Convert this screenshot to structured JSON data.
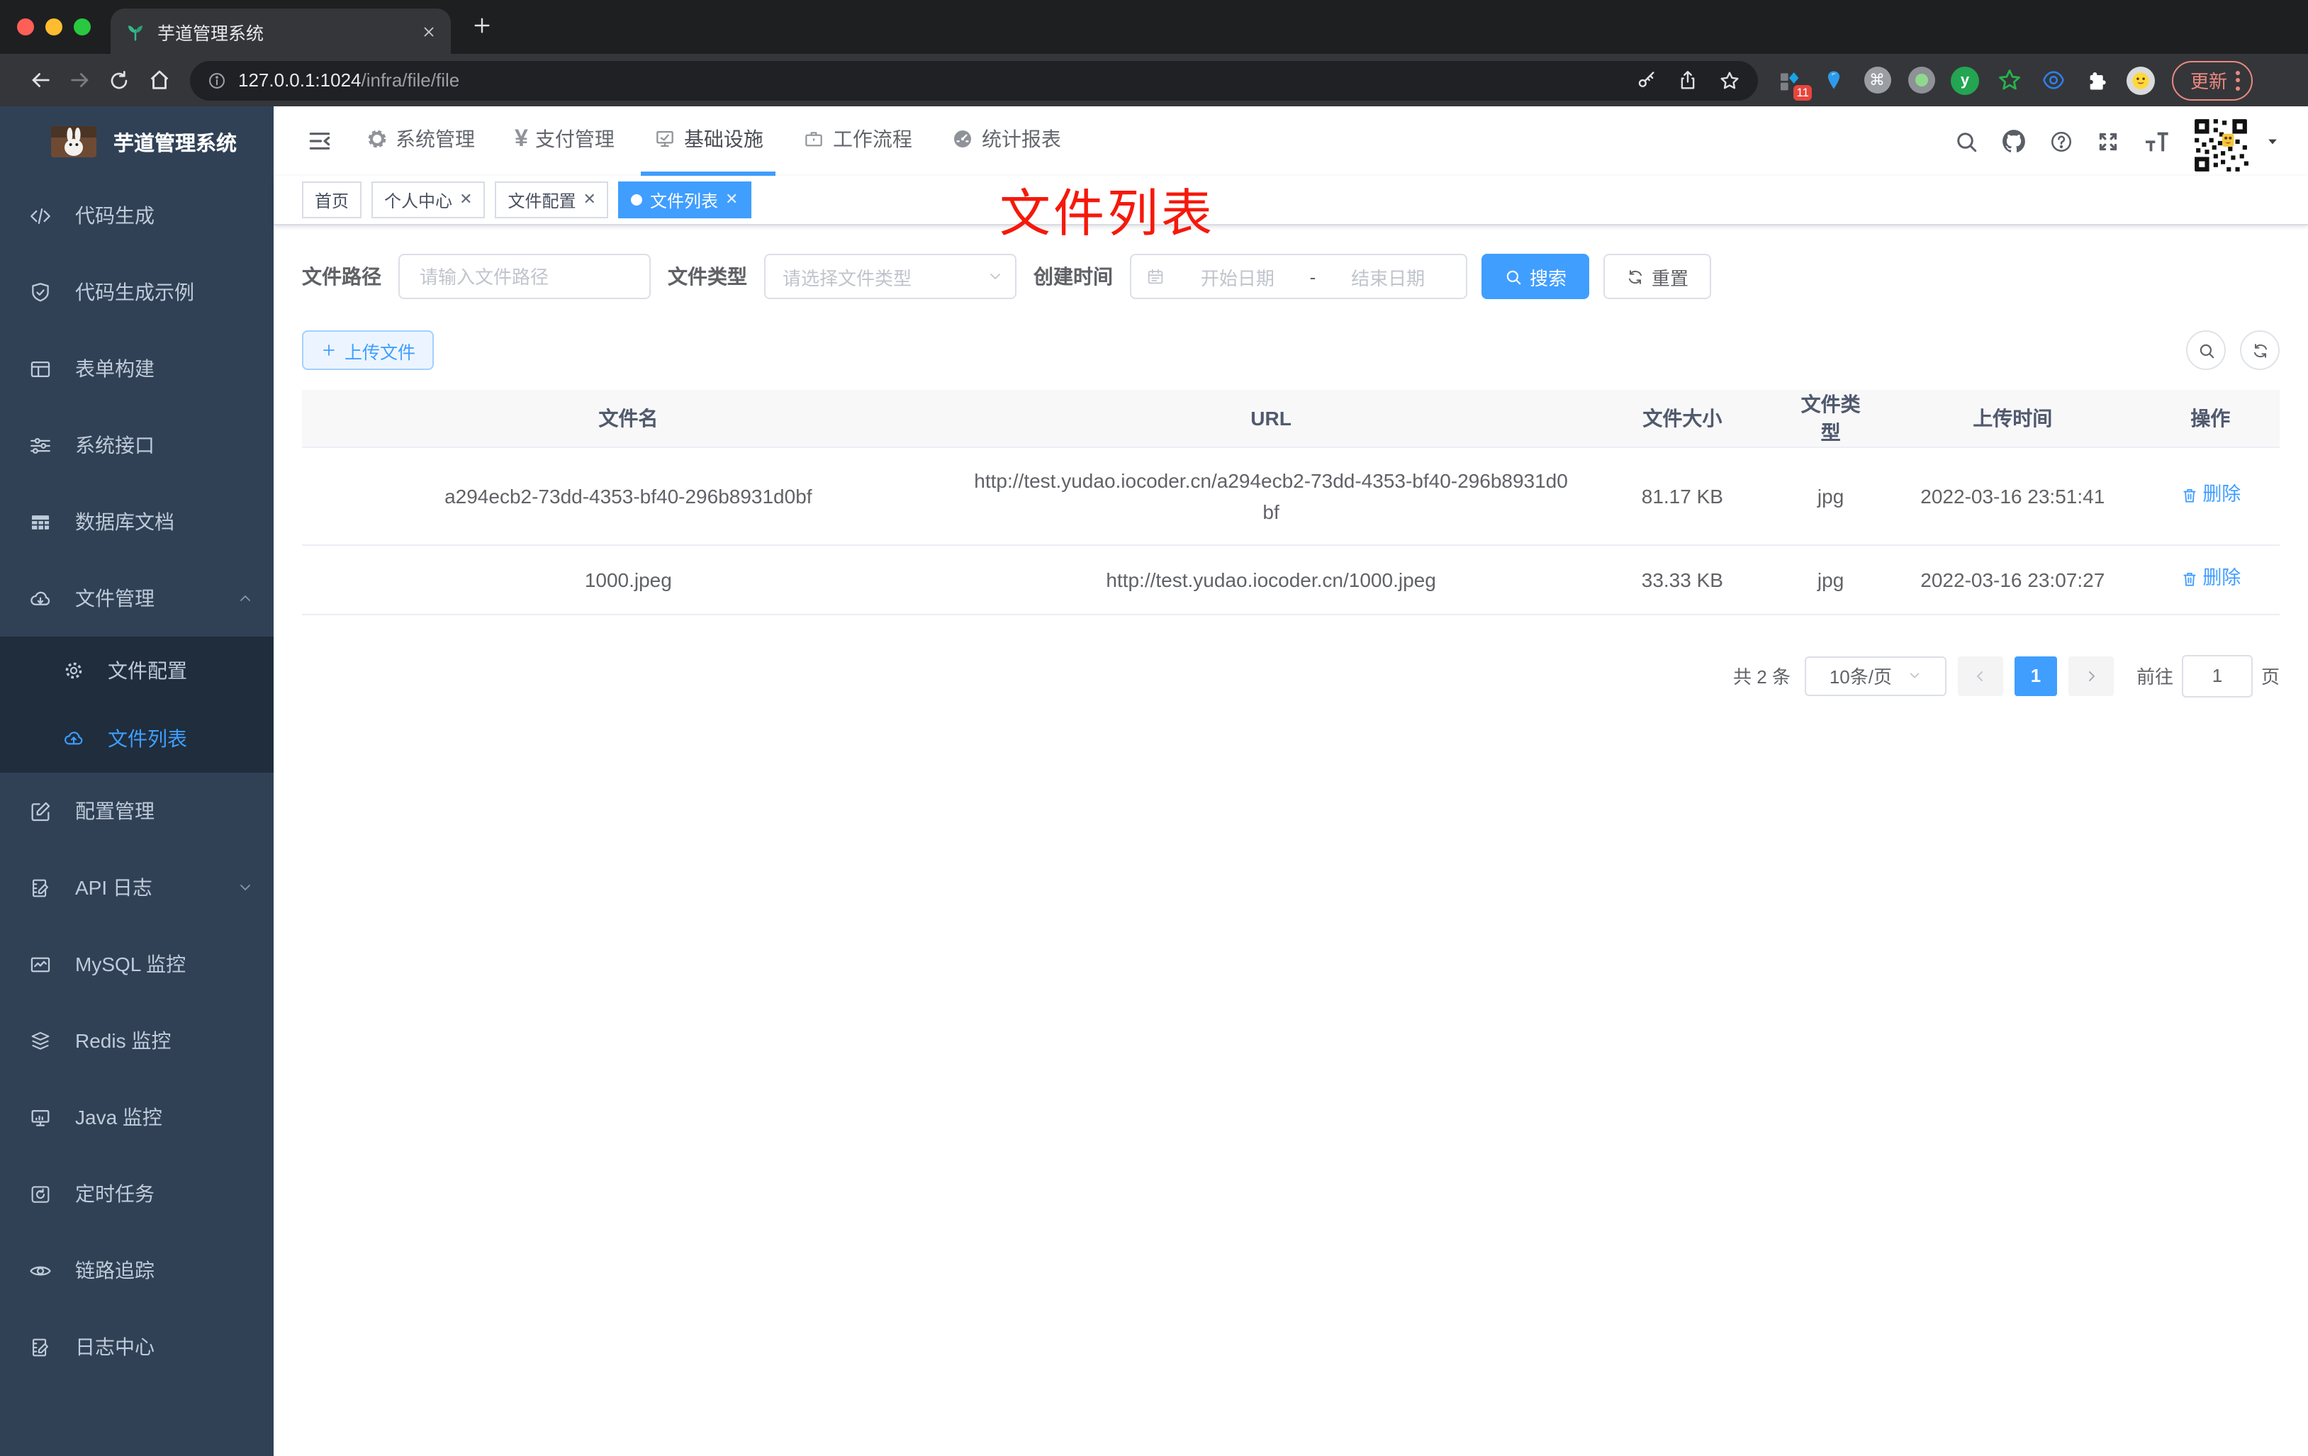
{
  "browser": {
    "tab_title": "芋道管理系统",
    "close_tab": "✕",
    "url_host": "127.0.0.1:1024",
    "url_path": "/infra/file/file",
    "ext_badge": "11",
    "ext_cmd": "⌘",
    "ext_y": "y",
    "update_label": "更新"
  },
  "sidebar": {
    "title": "芋道管理系统",
    "items": [
      {
        "label": "代码生成"
      },
      {
        "label": "代码生成示例"
      },
      {
        "label": "表单构建"
      },
      {
        "label": "系统接口"
      },
      {
        "label": "数据库文档"
      },
      {
        "label": "文件管理"
      },
      {
        "label": "文件配置"
      },
      {
        "label": "文件列表"
      },
      {
        "label": "配置管理"
      },
      {
        "label": "API 日志"
      },
      {
        "label": "MySQL 监控"
      },
      {
        "label": "Redis 监控"
      },
      {
        "label": "Java 监控"
      },
      {
        "label": "定时任务"
      },
      {
        "label": "链路追踪"
      },
      {
        "label": "日志中心"
      }
    ]
  },
  "topnav": {
    "items": [
      {
        "label": "系统管理"
      },
      {
        "label": "支付管理"
      },
      {
        "label": "基础设施"
      },
      {
        "label": "工作流程"
      },
      {
        "label": "统计报表"
      }
    ],
    "yen": "¥"
  },
  "tags": [
    {
      "label": "首页"
    },
    {
      "label": "个人中心",
      "close": "✕"
    },
    {
      "label": "文件配置",
      "close": "✕"
    },
    {
      "label": "文件列表",
      "close": "✕"
    }
  ],
  "annotation": {
    "text": "文件列表",
    "color": "#f5190b"
  },
  "filters": {
    "path_label": "文件路径",
    "path_placeholder": "请输入文件路径",
    "type_label": "文件类型",
    "type_placeholder": "请选择文件类型",
    "date_label": "创建时间",
    "date_start": "开始日期",
    "date_dash": "-",
    "date_end": "结束日期",
    "search_label": "搜索",
    "reset_label": "重置"
  },
  "toolbar": {
    "upload_label": "上传文件"
  },
  "table": {
    "headers": [
      "文件名",
      "URL",
      "文件大小",
      "文件类型",
      "上传时间",
      "操作"
    ],
    "rows": [
      {
        "name": "a294ecb2-73dd-4353-bf40-296b8931d0bf",
        "url": "http://test.yudao.iocoder.cn/a294ecb2-73dd-4353-bf40-296b8931d0bf",
        "size": "81.17 KB",
        "type": "jpg",
        "time": "2022-03-16 23:51:41",
        "action": "删除"
      },
      {
        "name": "1000.jpeg",
        "url": "http://test.yudao.iocoder.cn/1000.jpeg",
        "size": "33.33 KB",
        "type": "jpg",
        "time": "2022-03-16 23:07:27",
        "action": "删除"
      }
    ]
  },
  "pagination": {
    "total": "共 2 条",
    "page_size": "10条/页",
    "page": "1",
    "goto_label": "前往",
    "goto_value": "1",
    "page_label": "页"
  },
  "colors": {
    "accent": "#409eff",
    "sidebar": "#304156",
    "annotation": "#f5190b"
  }
}
